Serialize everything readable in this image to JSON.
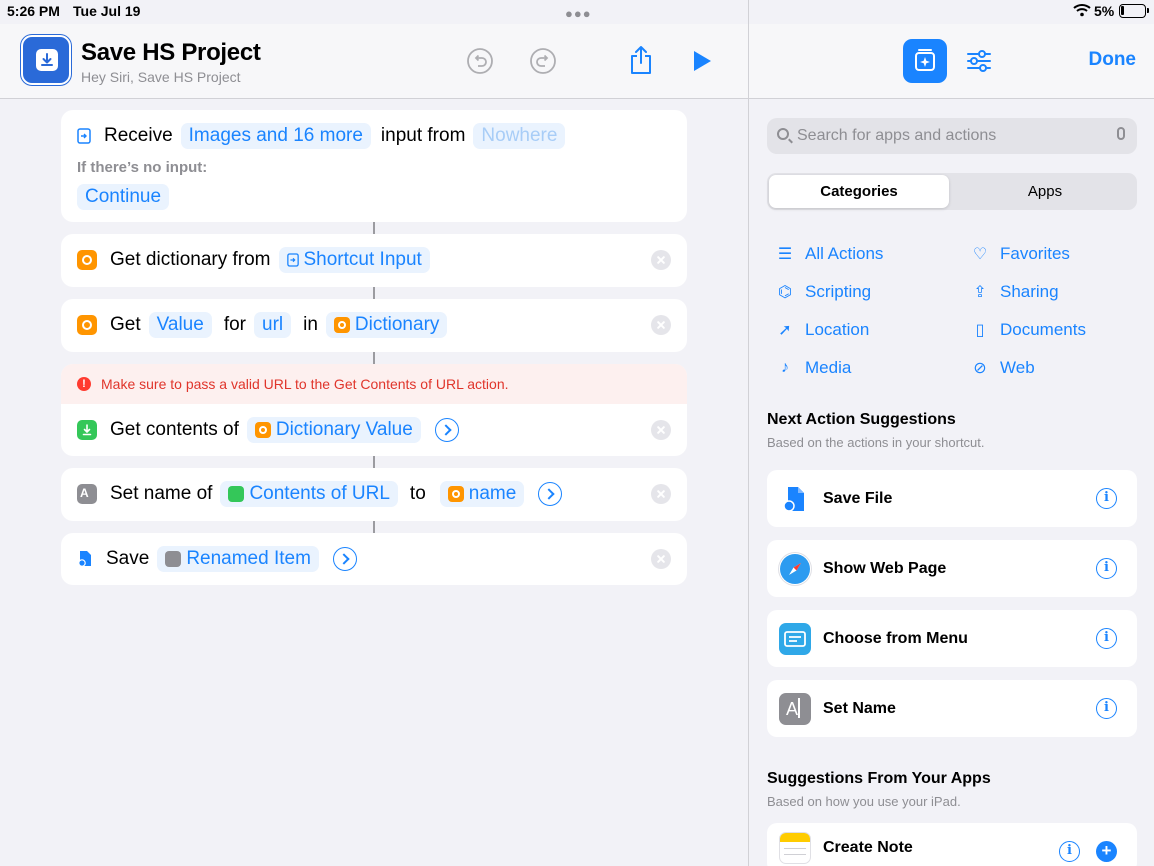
{
  "status": {
    "time": "5:26 PM",
    "date": "Tue Jul 19",
    "battery": "5%"
  },
  "header": {
    "title": "Save HS Project",
    "subtitle": "Hey Siri, Save HS Project"
  },
  "actions": {
    "receive": {
      "verb": "Receive",
      "types": "Images and 16 more",
      "mid": "input from",
      "source": "Nowhere",
      "no_input_label": "If there’s no input:",
      "no_input_value": "Continue"
    },
    "get_dict": {
      "text": "Get dictionary from",
      "param": "Shortcut Input"
    },
    "get_value": {
      "verb": "Get",
      "value": "Value",
      "for": "for",
      "key": "url",
      "in": "in",
      "dict": "Dictionary"
    },
    "get_contents": {
      "warning": "Make sure to pass a valid URL to the Get Contents of URL action.",
      "text": "Get contents of",
      "param": "Dictionary Value"
    },
    "set_name": {
      "text": "Set name of",
      "param": "Contents of URL",
      "to": "to",
      "name": "name"
    },
    "save": {
      "text": "Save",
      "param": "Renamed Item"
    }
  },
  "panel": {
    "done": "Done",
    "search_placeholder": "Search for apps and actions",
    "segments": [
      "Categories",
      "Apps"
    ],
    "categories": [
      {
        "label": "All Actions",
        "icon": "list-icon"
      },
      {
        "label": "Favorites",
        "icon": "heart-icon"
      },
      {
        "label": "Scripting",
        "icon": "scripting-icon"
      },
      {
        "label": "Sharing",
        "icon": "share-icon"
      },
      {
        "label": "Location",
        "icon": "location-icon"
      },
      {
        "label": "Documents",
        "icon": "document-icon"
      },
      {
        "label": "Media",
        "icon": "music-note-icon"
      },
      {
        "label": "Web",
        "icon": "compass-icon"
      }
    ],
    "next_title": "Next Action Suggestions",
    "next_sub": "Based on the actions in your shortcut.",
    "next_items": [
      "Save File",
      "Show Web Page",
      "Choose from Menu",
      "Set Name"
    ],
    "apps_title": "Suggestions From Your Apps",
    "apps_sub": "Based on how you use your iPad.",
    "apps_items": [
      "Create Note"
    ]
  },
  "colors": {
    "accent": "#1a84ff",
    "orange": "#ff9500",
    "green": "#34c759",
    "error": "#ff3b30"
  }
}
